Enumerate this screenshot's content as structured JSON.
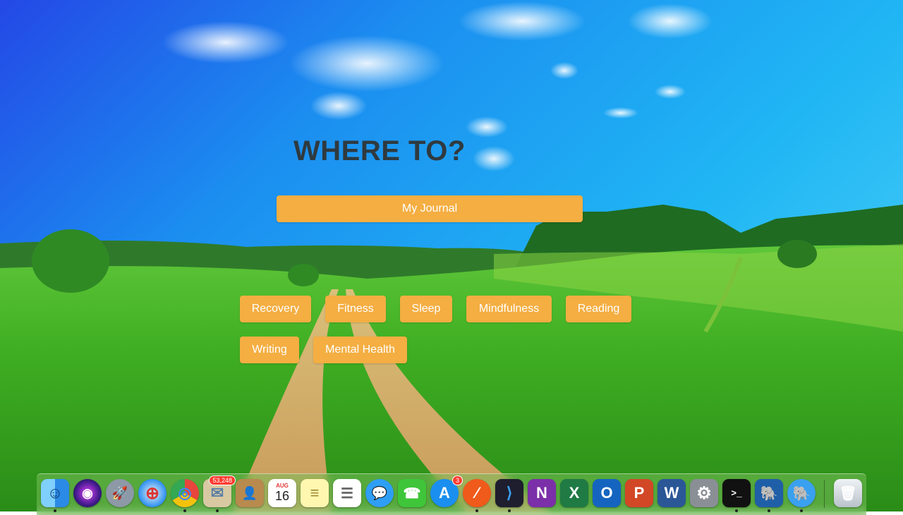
{
  "heading": "WHERE TO?",
  "primary_button": "My Journal",
  "categories": [
    "Recovery",
    "Fitness",
    "Sleep",
    "Mindfulness",
    "Reading",
    "Writing",
    "Mental Health"
  ],
  "colors": {
    "button": "#f4ae42",
    "heading": "#2f3a3f"
  },
  "dock": {
    "apps": [
      {
        "name": "finder-icon",
        "glyph": "☺"
      },
      {
        "name": "siri-icon",
        "glyph": "◉"
      },
      {
        "name": "launchpad-icon",
        "glyph": "🚀"
      },
      {
        "name": "safari-icon",
        "glyph": "⊕"
      },
      {
        "name": "chrome-icon",
        "glyph": "◎"
      },
      {
        "name": "mail-icon",
        "glyph": "✉",
        "badge": "53,248"
      },
      {
        "name": "contacts-icon",
        "glyph": "👤"
      },
      {
        "name": "calendar-icon",
        "glyph": "16",
        "month": "AUG"
      },
      {
        "name": "notes-icon",
        "glyph": "≡"
      },
      {
        "name": "reminders-icon",
        "glyph": "☰"
      },
      {
        "name": "messages-icon",
        "glyph": "💬"
      },
      {
        "name": "facetime-icon",
        "glyph": "☎"
      },
      {
        "name": "app-store-icon",
        "glyph": "A",
        "badge": "3"
      },
      {
        "name": "instruments-icon",
        "glyph": "⁄"
      },
      {
        "name": "vscode-icon",
        "glyph": "⟩"
      },
      {
        "name": "onenote-icon",
        "glyph": "N"
      },
      {
        "name": "excel-icon",
        "glyph": "X"
      },
      {
        "name": "outlook-icon",
        "glyph": "O"
      },
      {
        "name": "powerpoint-icon",
        "glyph": "P"
      },
      {
        "name": "word-icon",
        "glyph": "W"
      },
      {
        "name": "system-preferences-icon",
        "glyph": "⚙"
      },
      {
        "name": "terminal-icon",
        "glyph": ">_"
      },
      {
        "name": "tableplus-icon",
        "glyph": "🐘"
      },
      {
        "name": "sequel-icon",
        "glyph": "🐘"
      },
      {
        "name": "trash-icon",
        "glyph": "🗑"
      }
    ]
  }
}
